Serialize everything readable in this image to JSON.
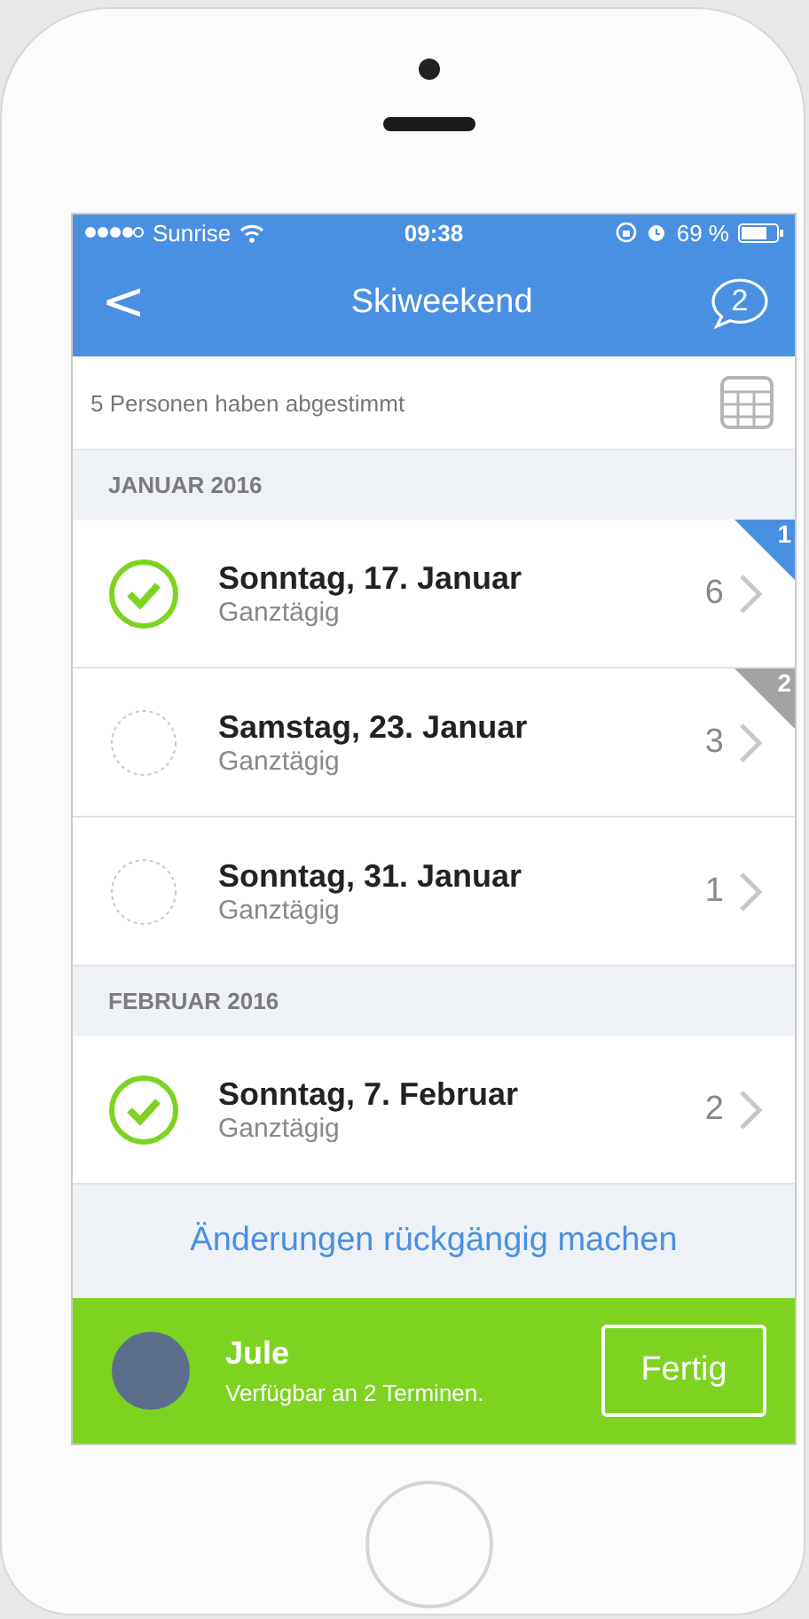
{
  "status_bar": {
    "carrier": "Sunrise",
    "time": "09:38",
    "battery": "69 %"
  },
  "nav": {
    "back": "<",
    "title": "Skiweekend",
    "comments": "2"
  },
  "votes_summary": "5 Personen haben abgestimmt",
  "sections": [
    {
      "title": "JANUAR 2016",
      "dates": [
        {
          "date": "Sonntag, 17. Januar",
          "subtitle": "Ganztägig",
          "count": "6",
          "checked": true,
          "rank": "1",
          "color": "#4a90e2"
        },
        {
          "date": "Samstag, 23. Januar",
          "subtitle": "Ganztägig",
          "count": "3",
          "checked": false,
          "rank": "2",
          "color": "#a4a4a4"
        },
        {
          "date": "Sonntag, 31. Januar",
          "subtitle": "Ganztägig",
          "count": "1",
          "checked": false
        }
      ]
    },
    {
      "title": "FEBRUAR 2016",
      "dates": [
        {
          "date": "Sonntag, 7. Februar",
          "subtitle": "Ganztägig",
          "count": "2",
          "checked": true
        }
      ]
    }
  ],
  "undo_link": "Änderungen rückgängig machen",
  "footer": {
    "name": "Jule",
    "subtitle": "Verfügbar an 2 Terminen.",
    "done_button": "Fertig"
  }
}
